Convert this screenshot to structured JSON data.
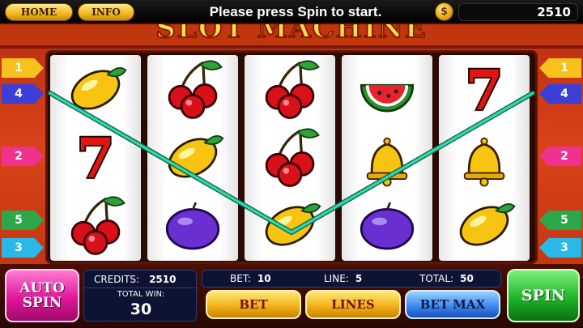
{
  "topbar": {
    "home_label": "HOME",
    "info_label": "INFO",
    "status_message": "Please press Spin to start.",
    "coin_symbol": "$",
    "balance": "2510"
  },
  "title": {
    "logo_text": "SLOT MACHINE"
  },
  "reels": [
    [
      "lemon",
      "seven",
      "cherry"
    ],
    [
      "cherry",
      "lemon",
      "plum"
    ],
    [
      "cherry",
      "cherry",
      "lemon"
    ],
    [
      "watermelon",
      "bell",
      "plum"
    ],
    [
      "seven",
      "bell",
      "lemon"
    ]
  ],
  "line_markers": {
    "left": [
      {
        "label": "1",
        "color": "#f7c21b"
      },
      {
        "label": "4",
        "color": "#3b3fd6"
      },
      {
        "label": "2",
        "color": "#f0318e"
      },
      {
        "label": "5",
        "color": "#2aa84a"
      },
      {
        "label": "3",
        "color": "#2ab8e6"
      }
    ],
    "right": [
      {
        "label": "1",
        "color": "#f7c21b"
      },
      {
        "label": "4",
        "color": "#3b3fd6"
      },
      {
        "label": "2",
        "color": "#f0318e"
      },
      {
        "label": "5",
        "color": "#2aa84a"
      },
      {
        "label": "3",
        "color": "#2ab8e6"
      }
    ]
  },
  "active_payline": {
    "number": "4",
    "color": "#2fd6a8"
  },
  "panel": {
    "auto_spin_label_1": "AUTO",
    "auto_spin_label_2": "SPIN",
    "credits_label": "CREDITS:",
    "credits_value": "2510",
    "total_win_label": "TOTAL WIN:",
    "total_win_value": "30",
    "bet_label": "BET:",
    "bet_value": "10",
    "line_label": "LINE:",
    "line_value": "5",
    "total_label": "TOTAL:",
    "total_value": "50",
    "bet_button": "BET",
    "lines_button": "LINES",
    "bet_max_button": "BET MAX",
    "spin_button": "SPIN"
  }
}
